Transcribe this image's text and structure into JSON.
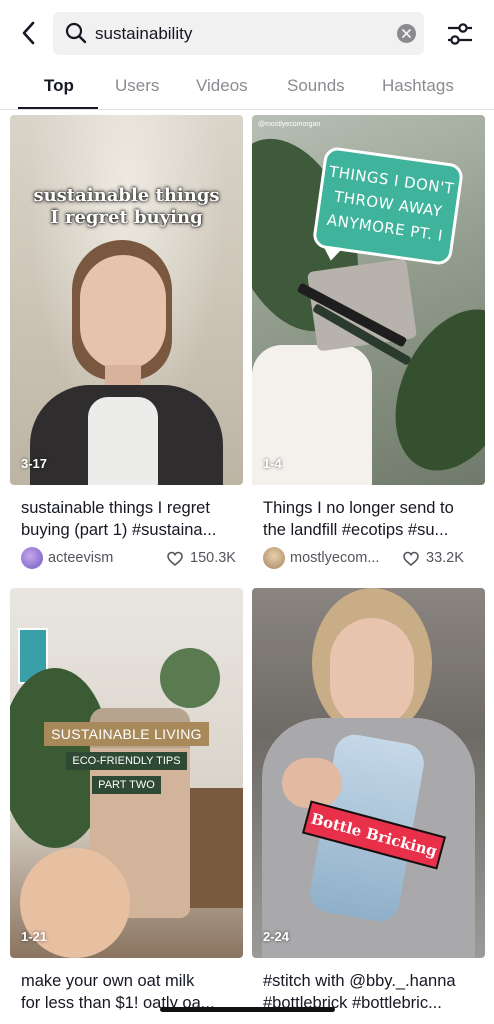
{
  "search": {
    "query": "sustainability"
  },
  "tabs": [
    "Top",
    "Users",
    "Videos",
    "Sounds",
    "Hashtags"
  ],
  "icons": {
    "back": "chevron-left-icon",
    "search": "search-icon",
    "clear": "clear-icon",
    "filter": "filter-sliders-icon",
    "heart": "heart-icon"
  },
  "results": [
    {
      "overlay": [
        "sustainable things",
        "I regret buying"
      ],
      "count": "3-17",
      "caption": [
        "sustainable things I regret",
        "buying (part 1) #sustaina..."
      ],
      "author": "acteevism",
      "likes": "150.3K"
    },
    {
      "watermark": "@mostlyecomorgan",
      "overlay": [
        "THINGS I DON'T",
        "THROW AWAY",
        "ANYMORE PT. I"
      ],
      "count": "1-4",
      "caption": [
        "Things I no longer send to",
        "the landfill #ecotips #su..."
      ],
      "author": "mostlyecom...",
      "likes": "33.2K"
    },
    {
      "overlay": [
        "SUSTAINABLE LIVING",
        "ECO-FRIENDLY TIPS",
        "PART TWO"
      ],
      "count": "1-21",
      "caption": [
        "make your own oat milk",
        "for less than $1! oatly oa..."
      ]
    },
    {
      "overlay": [
        "Bottle Bricking"
      ],
      "count": "2-24",
      "caption": [
        "#stitch with @bby._.hanna",
        "#bottlebrick #bottlebric..."
      ]
    }
  ],
  "colors": {
    "accent_teal": "#3fb39b",
    "tag_brown": "#a8895a",
    "tag_green": "#2e4a34",
    "sticker_red": "#e8304a"
  }
}
